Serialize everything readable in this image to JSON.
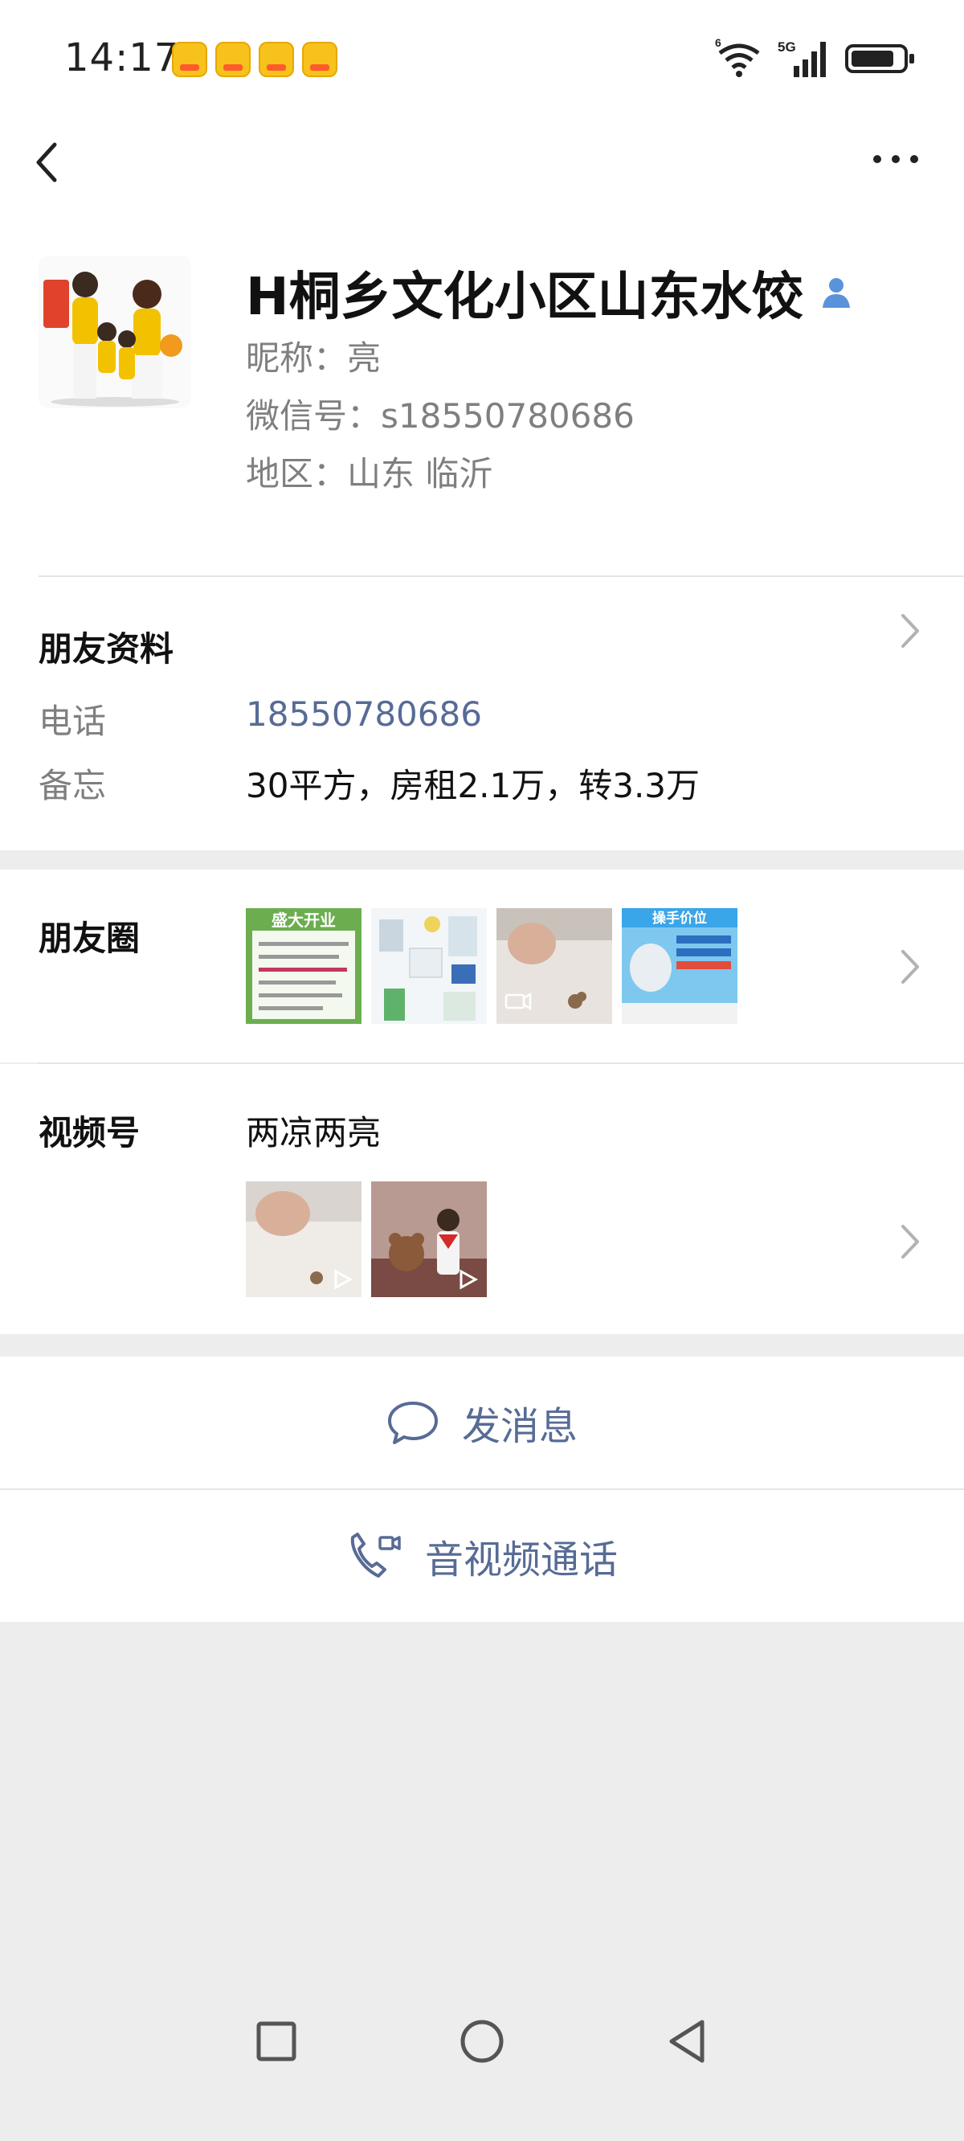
{
  "status_bar": {
    "time": "14:17",
    "network": "5G",
    "wifi_badge": "6"
  },
  "nav": {
    "back_icon": "chevron-left-icon",
    "more_icon": "more-dots-icon"
  },
  "profile": {
    "display_name": "H桐乡文化小区山东水饺",
    "nickname": "昵称：亮",
    "wechat_id": "微信号：s18550780686",
    "region": "地区：山东  临沂"
  },
  "friend_info": {
    "title": "朋友资料",
    "phone_label": "电话",
    "phone_value": "18550780686",
    "memo_label": "备忘",
    "memo_value": "30平方，房租2.1万，转3.3万"
  },
  "moments": {
    "title": "朋友圈",
    "thumbnails": [
      {
        "text": "盛大开业"
      },
      {
        "text": ""
      },
      {
        "text": ""
      },
      {
        "text": "操手价位"
      }
    ]
  },
  "channels": {
    "title": "视频号",
    "channel_name": "两凉两亮"
  },
  "actions": {
    "message_label": "发消息",
    "call_label": "音视频通话"
  },
  "colors": {
    "link": "#576b95",
    "background": "#ededed",
    "card": "#ffffff"
  }
}
